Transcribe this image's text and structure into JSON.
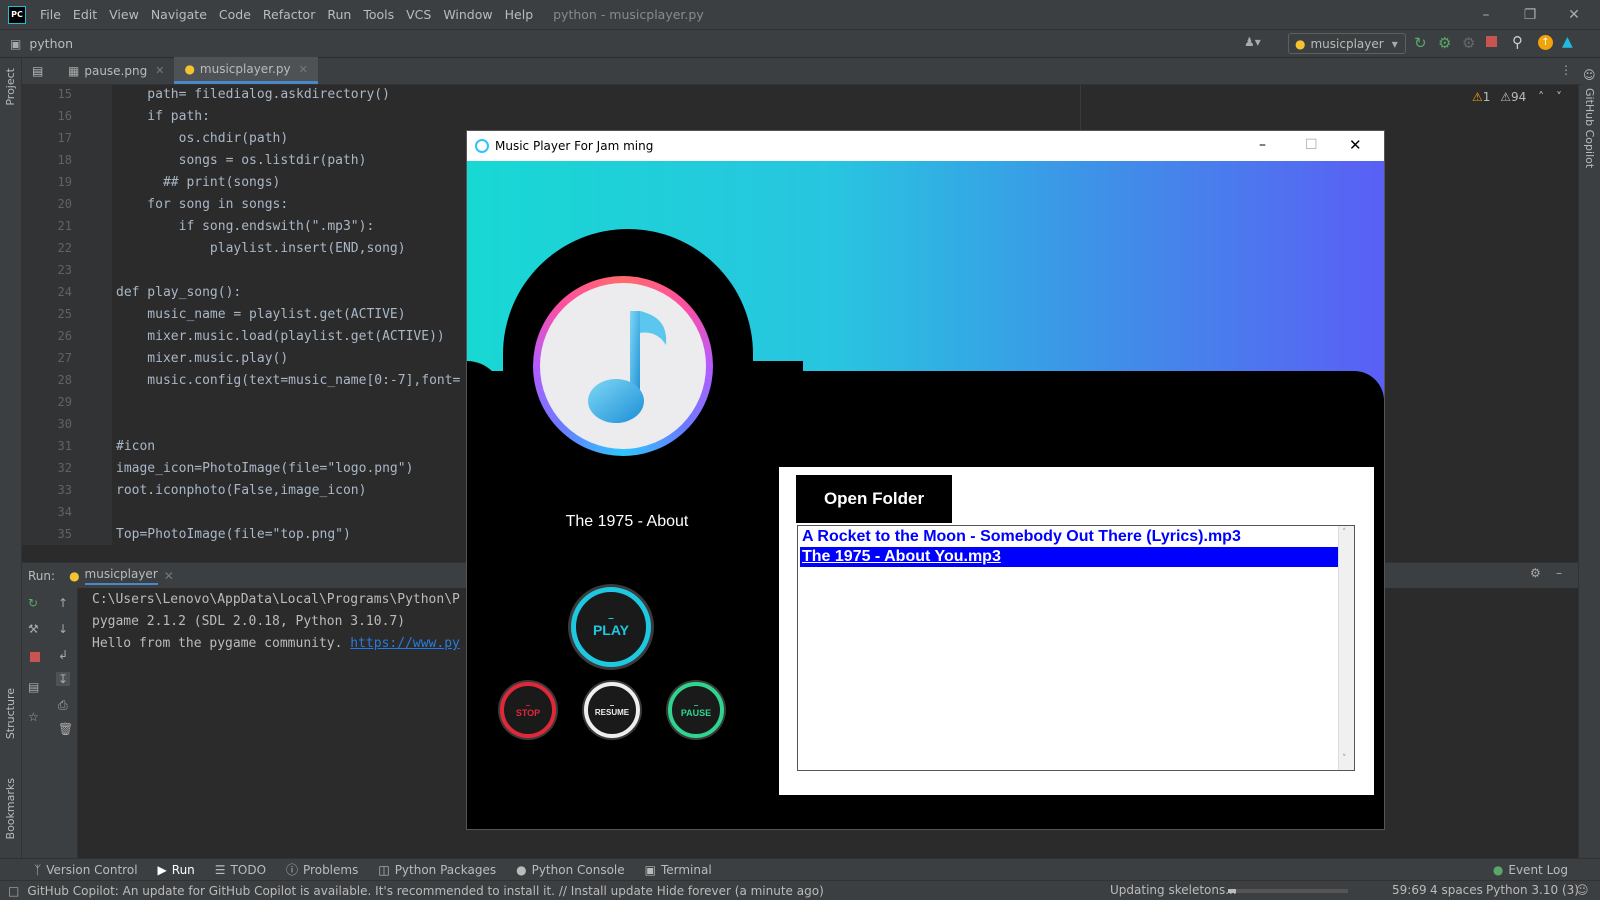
{
  "menubar": {
    "logo": "PC",
    "items": [
      "File",
      "Edit",
      "View",
      "Navigate",
      "Code",
      "Refactor",
      "Run",
      "Tools",
      "VCS",
      "Window",
      "Help"
    ],
    "title": "python - musicplayer.py"
  },
  "navbar": {
    "project": "python",
    "run_config": "musicplayer"
  },
  "tabs": [
    {
      "label": "pause.png"
    },
    {
      "label": "musicplayer.py"
    }
  ],
  "left_tools": {
    "project": "Project",
    "structure": "Structure",
    "bookmarks": "Bookmarks"
  },
  "right_tools": {
    "copilot": "GitHub Copilot"
  },
  "inspections": {
    "warnings": "1",
    "weak_warnings": "94"
  },
  "code": {
    "line_numbers": [
      "15",
      "16",
      "17",
      "18",
      "19",
      "20",
      "21",
      "22",
      "23",
      "24",
      "25",
      "26",
      "27",
      "28",
      "29",
      "30",
      "31",
      "32",
      "33",
      "34",
      "35"
    ],
    "lines": [
      "    path= filedialog.askdirectory()",
      "    if path:",
      "        os.chdir(path)",
      "        songs = os.listdir(path)",
      "      ## print(songs)",
      "    for song in songs:",
      "        if song.endswith(\".mp3\"):",
      "            playlist.insert(END,song)",
      "",
      "def play_song():",
      "    music_name = playlist.get(ACTIVE)",
      "    mixer.music.load(playlist.get(ACTIVE))",
      "    mixer.music.play()",
      "    music.config(text=music_name[0:-7],font=",
      "",
      "",
      "#icon",
      "image_icon=PhotoImage(file=\"logo.png\")",
      "root.iconphoto(False,image_icon)",
      "",
      "Top=PhotoImage(file=\"top.png\")"
    ]
  },
  "run": {
    "label": "Run:",
    "tab": "musicplayer",
    "console": [
      "C:\\Users\\Lenovo\\AppData\\Local\\Programs\\Python\\P",
      "pygame 2.1.2 (SDL 2.0.18, Python 3.10.7)",
      "Hello from the pygame community. "
    ],
    "link": "https://www.py"
  },
  "player": {
    "title": "Music Player For Jam ming",
    "now_playing": "The 1975 - About",
    "open_folder": "Open Folder",
    "play": "PLAY",
    "stop": "STOP",
    "resume": "RESUME",
    "pause": "PAUSE",
    "playlist": [
      "A Rocket to the Moon - Somebody Out There (Lyrics).mp3",
      "The 1975 - About You.mp3"
    ],
    "selected_index": 1
  },
  "toolwindows": [
    "Version Control",
    "Run",
    "TODO",
    "Problems",
    "Python Packages",
    "Python Console",
    "Terminal",
    "Event Log"
  ],
  "status": {
    "message": "GitHub Copilot: An update for GitHub Copilot is available. It's recommended to install it. // Install update   Hide forever (a minute ago)",
    "task": "Updating skeletons...",
    "position": "59:69",
    "indent": "4 spaces",
    "interpreter": "Python 3.10 (3)"
  },
  "colors": {
    "ide_bg": "#2b2b2b",
    "panel_bg": "#3c3f41",
    "keyword": "#cc7832",
    "string": "#6a8759",
    "selection": "#0000ff",
    "play_ring": "#1ec8e0",
    "stop_ring": "#e0283a",
    "pause_ring": "#2fd48e"
  }
}
